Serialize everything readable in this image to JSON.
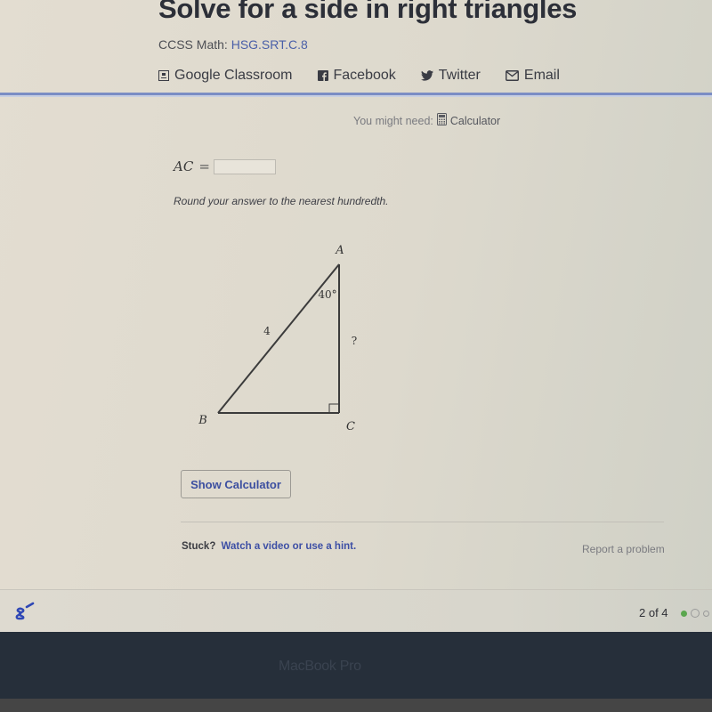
{
  "header": {
    "title": "Solve for a side in right triangles",
    "ccss_label": "CCSS Math:",
    "ccss_code": "HSG.SRT.C.8",
    "share": [
      {
        "label": "Google Classroom",
        "icon": "google-classroom-icon"
      },
      {
        "label": "Facebook",
        "icon": "facebook-icon"
      },
      {
        "label": "Twitter",
        "icon": "twitter-icon"
      },
      {
        "label": "Email",
        "icon": "email-icon"
      }
    ]
  },
  "exercise": {
    "might_need_label": "You might need:",
    "calculator_label": "Calculator",
    "answer_variable": "AC",
    "equals": "=",
    "answer_value": "",
    "instruction": "Round your answer to the nearest hundredth.",
    "diagram": {
      "vertex_a": "A",
      "vertex_b": "B",
      "vertex_c": "C",
      "angle_a": "40°",
      "side_ab": "4",
      "side_ac": "?"
    },
    "show_calculator_label": "Show Calculator"
  },
  "help": {
    "stuck_label": "Stuck?",
    "hint_link": "Watch a video or use a hint.",
    "report_label": "Report a problem"
  },
  "footer": {
    "progress_text": "2 of 4",
    "progress": {
      "current": 2,
      "total": 4,
      "completed": 1
    },
    "accent_color": "#5aa74e"
  },
  "device": {
    "bezel_label": "MacBook Pro"
  }
}
